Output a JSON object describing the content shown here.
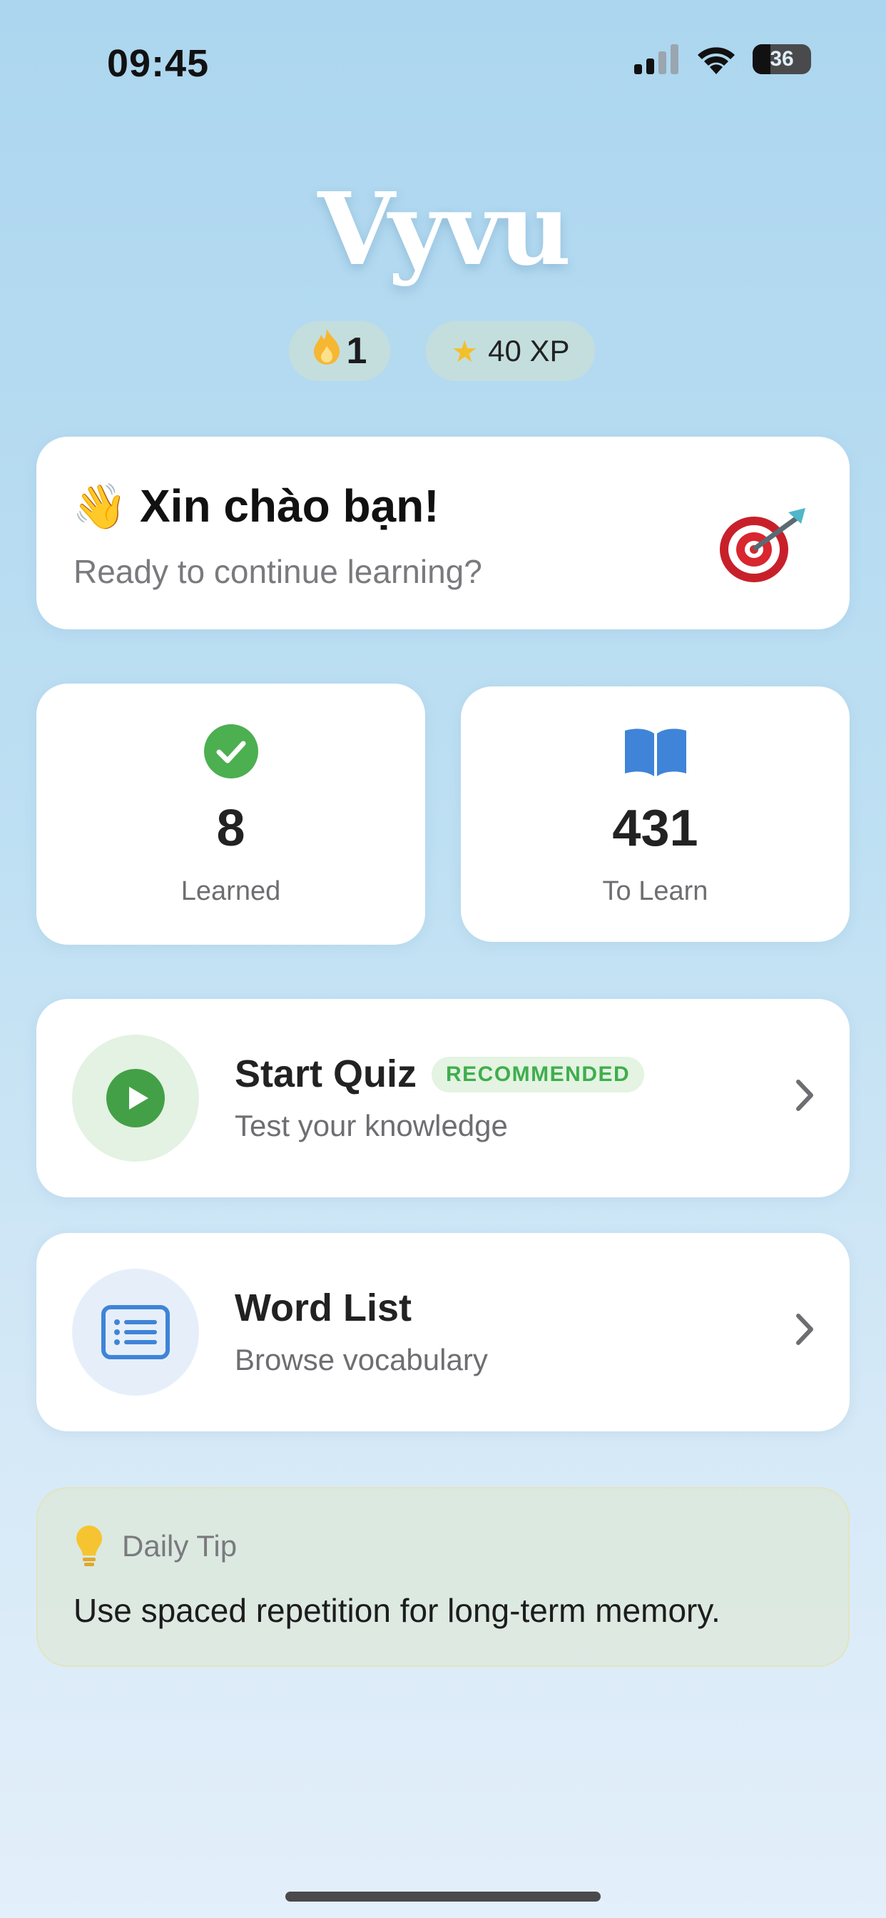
{
  "status_bar": {
    "time": "09:45",
    "battery": "36"
  },
  "header": {
    "app_name": "Vyvu",
    "streak": "1",
    "xp": "40 XP"
  },
  "greeting": {
    "title": "Xin chào bạn!",
    "subtitle": "Ready to continue learning?",
    "wave_emoji": "👋"
  },
  "stats": [
    {
      "value": "8",
      "label": "Learned",
      "icon": "check-circle-icon",
      "color": "#4caf50"
    },
    {
      "value": "431",
      "label": "To Learn",
      "icon": "book-icon",
      "color": "#3f84d8"
    }
  ],
  "actions": {
    "quiz": {
      "title": "Start Quiz",
      "badge": "RECOMMENDED",
      "subtitle": "Test your knowledge",
      "icon": "play-icon",
      "color": "#43a047"
    },
    "words": {
      "title": "Word List",
      "subtitle": "Browse vocabulary",
      "icon": "list-icon",
      "color": "#3f84d8"
    }
  },
  "tip": {
    "label": "Daily Tip",
    "text": "Use spaced repetition for long-term memory.",
    "icon": "lightbulb-icon"
  }
}
